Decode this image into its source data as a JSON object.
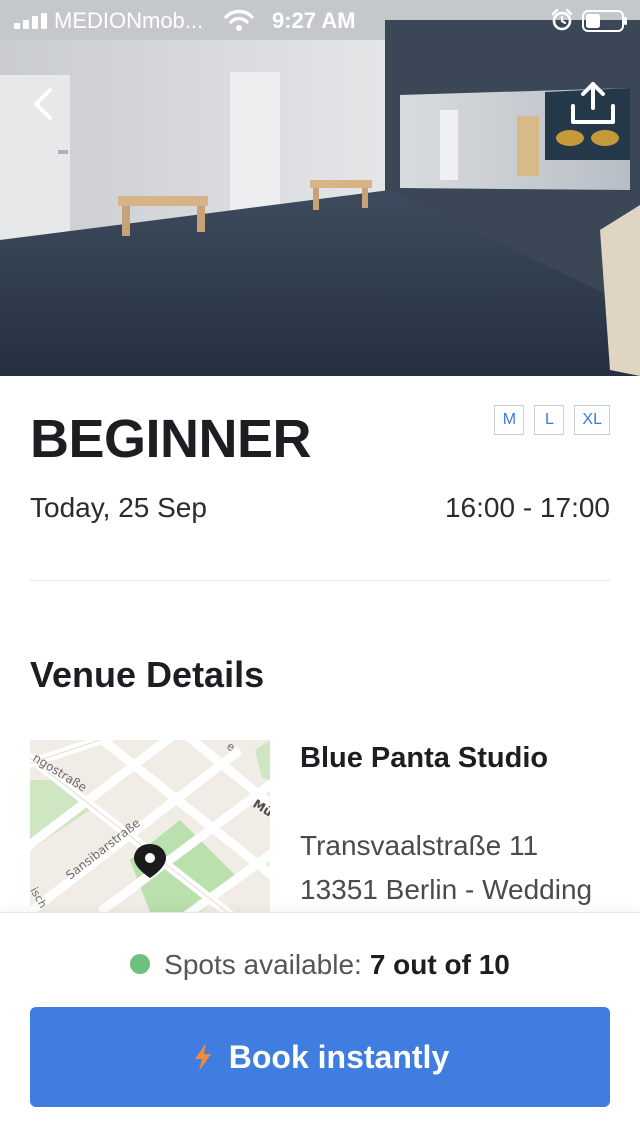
{
  "status_bar": {
    "carrier": "MEDIONmob...",
    "time": "9:27 AM"
  },
  "header_icons": {
    "back": "chevron-left-icon",
    "share": "share-upload-icon"
  },
  "class_info": {
    "title": "BEGINNER",
    "sizes": [
      "M",
      "L",
      "XL"
    ],
    "date": "Today, 25 Sep",
    "time_range": "16:00 - 17:00"
  },
  "venue": {
    "heading": "Venue Details",
    "name": "Blue Panta Studio",
    "address_line1": "Transvaalstraße 11",
    "address_line2": "13351 Berlin - Wedding",
    "map_labels": [
      "ngostraße",
      "Sansibarstraße",
      "Mü",
      "e",
      "isch"
    ]
  },
  "booking": {
    "spots_label": "Spots available:",
    "spots_value": "7 out of 10",
    "button_label": "Book instantly"
  },
  "colors": {
    "accent": "#3f7ee0",
    "available_dot": "#6fbf7f",
    "bolt": "#f08a3c"
  }
}
